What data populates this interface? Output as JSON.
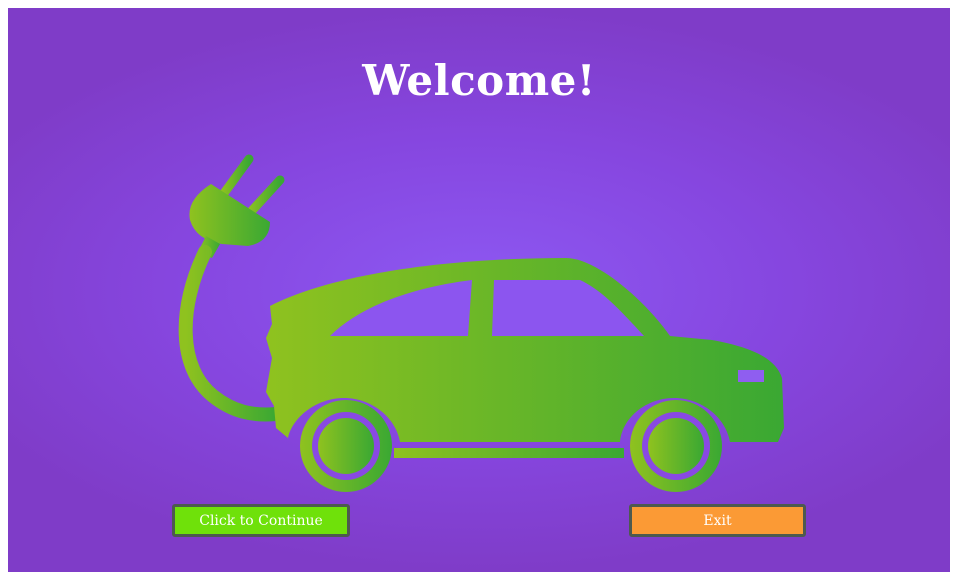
{
  "screen": {
    "title": "Welcome!"
  },
  "buttons": {
    "continue_label": "Click to Continue",
    "exit_label": "Exit"
  },
  "illustration": {
    "icon": "electric-car-icon",
    "colors": {
      "gradient_start": "#8fc21f",
      "gradient_end": "#3aa833"
    }
  },
  "colors": {
    "background": "#8646df",
    "continue_button": "#6fe10a",
    "exit_button": "#fb9a35",
    "button_border": "#4d5a4f",
    "text": "#ffffff"
  }
}
